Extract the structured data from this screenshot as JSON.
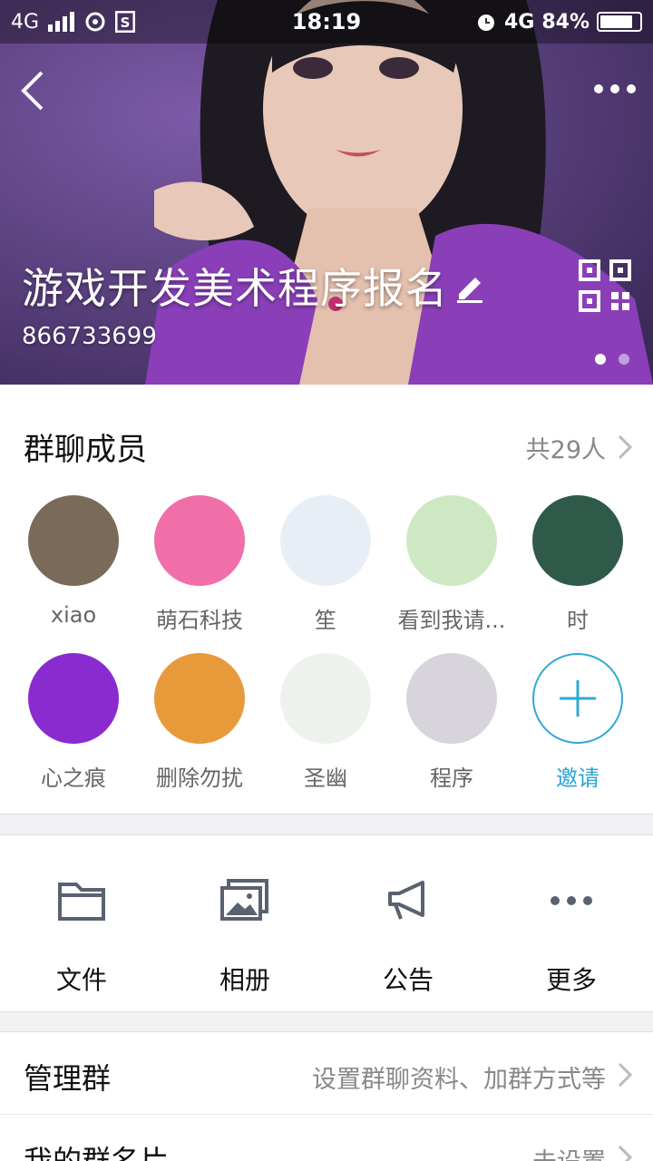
{
  "status_bar": {
    "network_left": "4G",
    "time": "18:19",
    "network_right": "4G",
    "battery": "84%",
    "battery_level": 0.84
  },
  "hero": {
    "group_name": "游戏开发美术程序报名",
    "group_id": "866733699",
    "page_count": 2,
    "active_page": 0,
    "icons": [
      "back-arrow-icon",
      "more-dots-icon",
      "edit-pencil-icon",
      "qr-code-icon"
    ]
  },
  "members": {
    "title": "群聊成员",
    "count_label": "共29人",
    "items": [
      {
        "name": "xiao",
        "avatar_color": "#7a6a5a"
      },
      {
        "name": "萌石科技",
        "avatar_color": "#f06fa8"
      },
      {
        "name": "笙",
        "avatar_color": "#e8eef6"
      },
      {
        "name": "看到我请...",
        "avatar_color": "#cfe8c4"
      },
      {
        "name": "时",
        "avatar_color": "#2f5a4a"
      },
      {
        "name": "心之痕",
        "avatar_color": "#8a2bd0"
      },
      {
        "name": "删除勿扰",
        "avatar_color": "#e69a3a"
      },
      {
        "name": "圣幽",
        "avatar_color": "#eef2ec"
      },
      {
        "name": "程序",
        "avatar_color": "#d8d4dc"
      }
    ],
    "invite_label": "邀请",
    "accent": "#2fa8d8"
  },
  "actions": [
    {
      "label": "文件",
      "icon": "folder-icon"
    },
    {
      "label": "相册",
      "icon": "album-icon"
    },
    {
      "label": "公告",
      "icon": "megaphone-icon"
    },
    {
      "label": "更多",
      "icon": "more-dots-icon"
    }
  ],
  "rows": [
    {
      "title": "管理群",
      "value": "设置群聊资料、加群方式等"
    },
    {
      "title": "我的群名片",
      "value": "未设置"
    }
  ]
}
